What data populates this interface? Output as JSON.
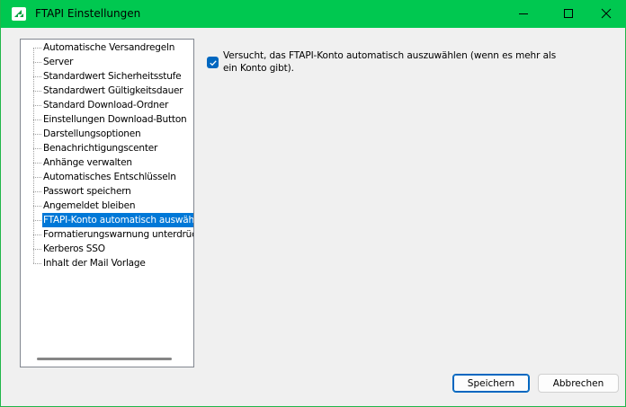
{
  "window": {
    "title": "FTAPI Einstellungen",
    "accent_color": "#00c850"
  },
  "tree": {
    "items": [
      {
        "label": "Automatische Versandregeln"
      },
      {
        "label": "Server"
      },
      {
        "label": "Standardwert Sicherheitsstufe"
      },
      {
        "label": "Standardwert Gültigkeitsdauer"
      },
      {
        "label": "Standard Download-Ordner"
      },
      {
        "label": "Einstellungen Download-Button"
      },
      {
        "label": "Darstellungsoptionen"
      },
      {
        "label": "Benachrichtigungscenter"
      },
      {
        "label": "Anhänge verwalten"
      },
      {
        "label": "Automatisches Entschlüsseln"
      },
      {
        "label": "Passwort speichern"
      },
      {
        "label": "Angemeldet bleiben"
      },
      {
        "label": "FTAPI-Konto automatisch auswählen",
        "selected": true
      },
      {
        "label": "Formatierungswarnung unterdrücken"
      },
      {
        "label": "Kerberos SSO"
      },
      {
        "label": "Inhalt der Mail Vorlage"
      }
    ],
    "selected_color": "#0078d7"
  },
  "option": {
    "checked": true,
    "label": "Versucht, das FTAPI-Konto automatisch auszuwählen (wenn es mehr als ein Konto gibt)."
  },
  "buttons": {
    "save_label": "Speichern",
    "cancel_label": "Abbrechen"
  }
}
